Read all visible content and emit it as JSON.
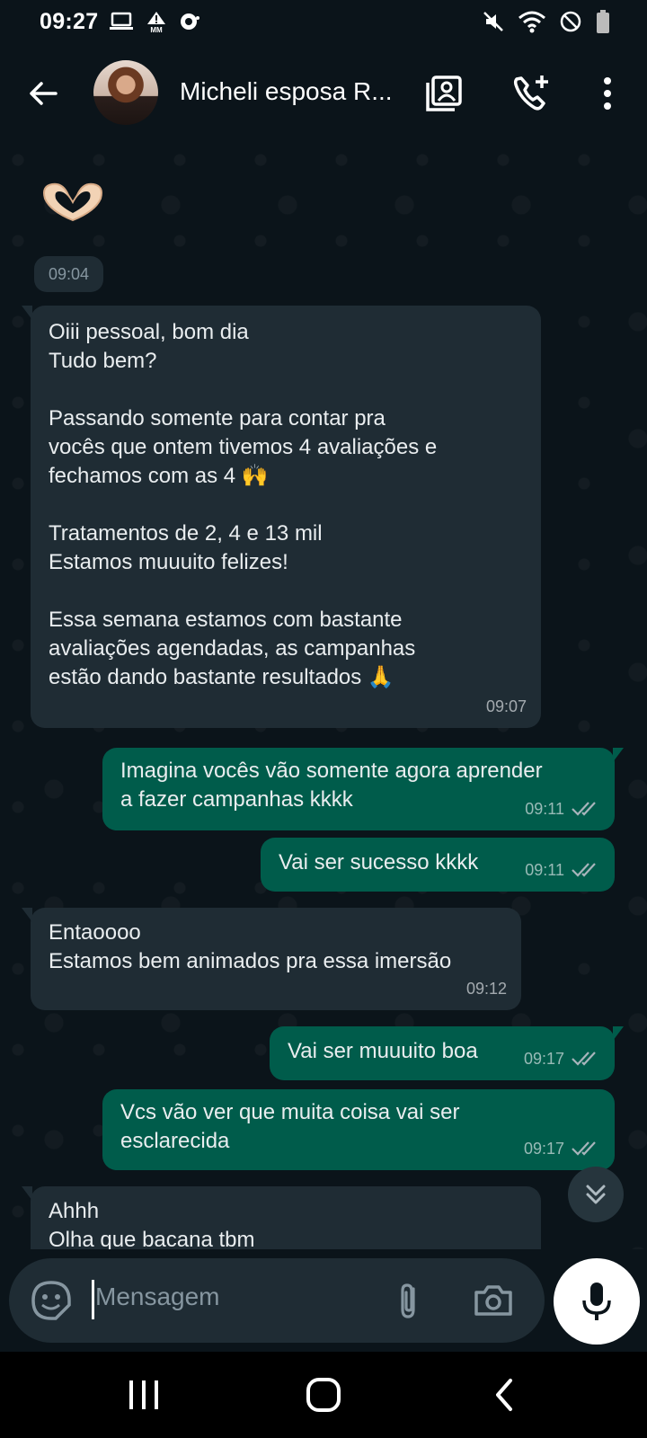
{
  "status_bar": {
    "time": "09:27",
    "left_icons": [
      "laptop-icon",
      "alert-mm-icon",
      "chat-dot-icon"
    ],
    "right_icons": [
      "mute-icon",
      "wifi-icon",
      "do-not-disturb-icon",
      "battery-icon"
    ]
  },
  "header": {
    "contact_name": "Micheli esposa R...",
    "icons": [
      "back-arrow-icon",
      "contact-card-icon",
      "add-call-icon",
      "more-vert-icon"
    ]
  },
  "chat": {
    "emoji": "🫶",
    "date_chip_time": "09:04",
    "messages": [
      {
        "direction": "in",
        "text": "Oiii pessoal, bom dia\nTudo bem?\n\nPassando somente para contar pra\nvocês que ontem tivemos 4 avaliações e\nfechamos com as 4 🙌\n\nTratamentos de 2, 4 e 13 mil\nEstamos muuuito felizes!\n\nEssa semana estamos com bastante\navaliações agendadas, as campanhas\nestão dando bastante resultados 🙏",
        "time": "09:07"
      },
      {
        "direction": "out",
        "text": "Imagina vocês vão somente agora aprender\na fazer campanhas kkkk",
        "time": "09:11",
        "read": true
      },
      {
        "direction": "out",
        "text": "Vai ser sucesso kkkk",
        "time": "09:11",
        "read": true
      },
      {
        "direction": "in",
        "text": "Entaoooo\nEstamos bem animados pra essa imersão",
        "time": "09:12"
      },
      {
        "direction": "out",
        "text": "Vai ser muuuito boa",
        "time": "09:17",
        "read": true
      },
      {
        "direction": "out",
        "text": "Vcs vão ver que muita coisa vai ser\nesclarecida",
        "time": "09:17",
        "read": true
      },
      {
        "direction": "in",
        "text": "Ahhh\nOlha que bacana tbm",
        "time": ""
      }
    ]
  },
  "input": {
    "placeholder": "Mensagem",
    "icons": [
      "sticker-icon",
      "attach-icon",
      "camera-icon",
      "mic-icon"
    ]
  },
  "nav": {
    "icons": [
      "recents-icon",
      "home-icon",
      "back-icon"
    ]
  },
  "colors": {
    "background": "#0b141a",
    "incoming_bubble": "#1f2c34",
    "outgoing_bubble": "#005c4b",
    "meta_text": "#8696a0"
  }
}
